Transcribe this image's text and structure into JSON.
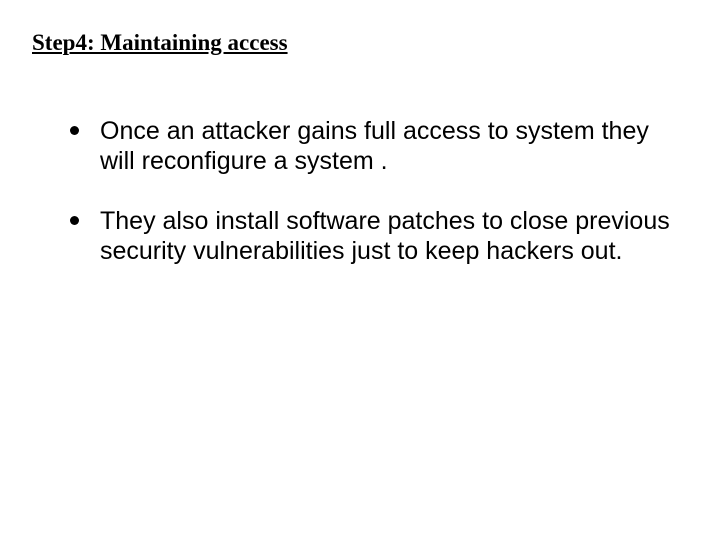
{
  "title": "Step4: Maintaining access",
  "bullets": [
    "Once an attacker gains full access to system they will reconfigure a system .",
    "They also install software patches to close previous  security vulnerabilities just to keep hackers out."
  ]
}
